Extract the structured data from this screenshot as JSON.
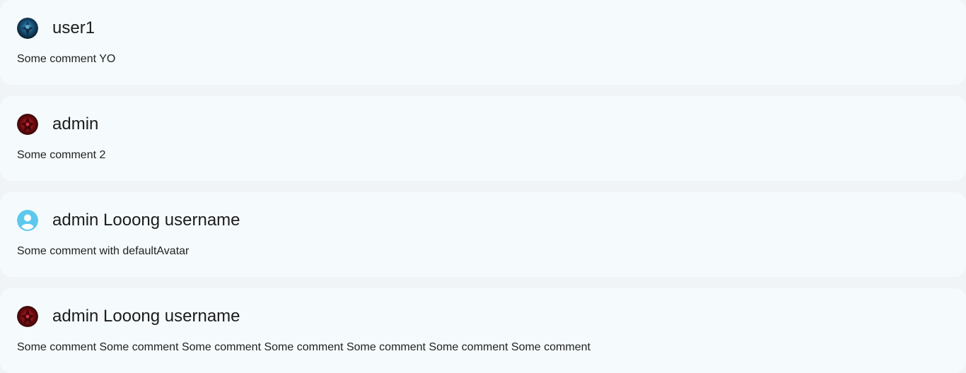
{
  "comments": [
    {
      "username": "user1",
      "text": "Some comment YO",
      "avatar": {
        "icon": "user-photo-blue",
        "colors": [
          "#0b2a3f",
          "#2f7fb0",
          "#0a1a26"
        ]
      }
    },
    {
      "username": "admin",
      "text": "Some comment 2",
      "avatar": {
        "icon": "user-photo-red",
        "colors": [
          "#3a0608",
          "#c2161c",
          "#1a0203"
        ]
      }
    },
    {
      "username": "admin Looong username",
      "text": "Some comment with defaultAvatar",
      "avatar": {
        "icon": "default-avatar-icon",
        "colors": [
          "#5cc8ee",
          "#ffffff"
        ]
      }
    },
    {
      "username": "admin Looong username",
      "text": "Some comment Some comment Some comment Some comment Some comment Some comment Some comment",
      "avatar": {
        "icon": "user-photo-red",
        "colors": [
          "#3a0608",
          "#c2161c",
          "#1a0203"
        ]
      }
    }
  ]
}
